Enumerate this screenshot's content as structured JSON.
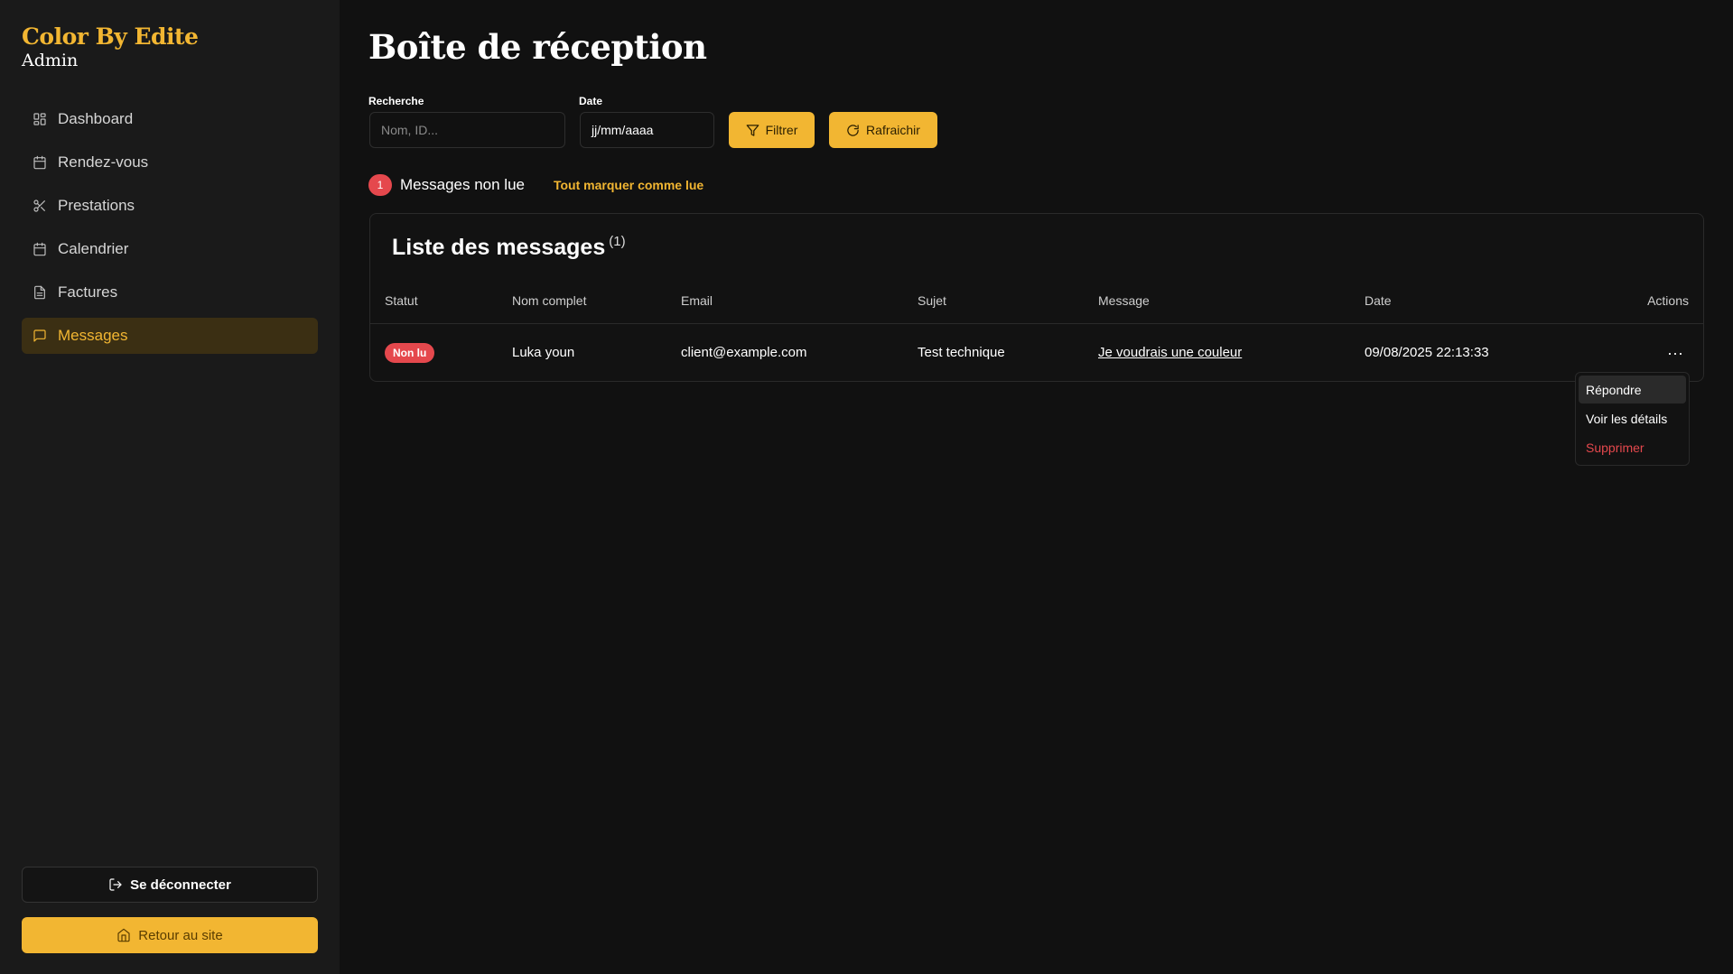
{
  "brand": {
    "title": "Color By Edite",
    "subtitle": "Admin"
  },
  "sidebar": {
    "items": [
      {
        "label": "Dashboard",
        "icon": "grid-icon"
      },
      {
        "label": "Rendez-vous",
        "icon": "calendar-icon"
      },
      {
        "label": "Prestations",
        "icon": "scissors-icon"
      },
      {
        "label": "Calendrier",
        "icon": "calendar-icon"
      },
      {
        "label": "Factures",
        "icon": "file-text-icon"
      },
      {
        "label": "Messages",
        "icon": "message-square-icon",
        "active": true
      }
    ],
    "logout_label": "Se déconnecter",
    "home_label": "Retour au site"
  },
  "page": {
    "title": "Boîte de réception"
  },
  "filters": {
    "search_label": "Recherche",
    "search_placeholder": "Nom, ID...",
    "date_label": "Date",
    "date_value": "jj/mm/aaaa",
    "filter_button": "Filtrer",
    "refresh_button": "Rafraichir"
  },
  "unread": {
    "count": "1",
    "label": "Messages non lue",
    "mark_all": "Tout marquer comme lue"
  },
  "messages": {
    "title": "Liste des messages",
    "count": "(1)",
    "columns": [
      "Statut",
      "Nom complet",
      "Email",
      "Sujet",
      "Message",
      "Date",
      "Actions"
    ],
    "rows": [
      {
        "status": "Non lu",
        "name": "Luka youn",
        "email": "client@example.com",
        "subject": "Test technique",
        "message": "Je voudrais une couleur",
        "date": "09/08/2025 22:13:33"
      }
    ],
    "actions_menu": [
      "Répondre",
      "Voir les détails",
      "Supprimer"
    ]
  },
  "colors": {
    "accent": "#f2b632",
    "danger": "#e5484d",
    "background": "#111111",
    "sidebar": "#1a1a1a"
  }
}
